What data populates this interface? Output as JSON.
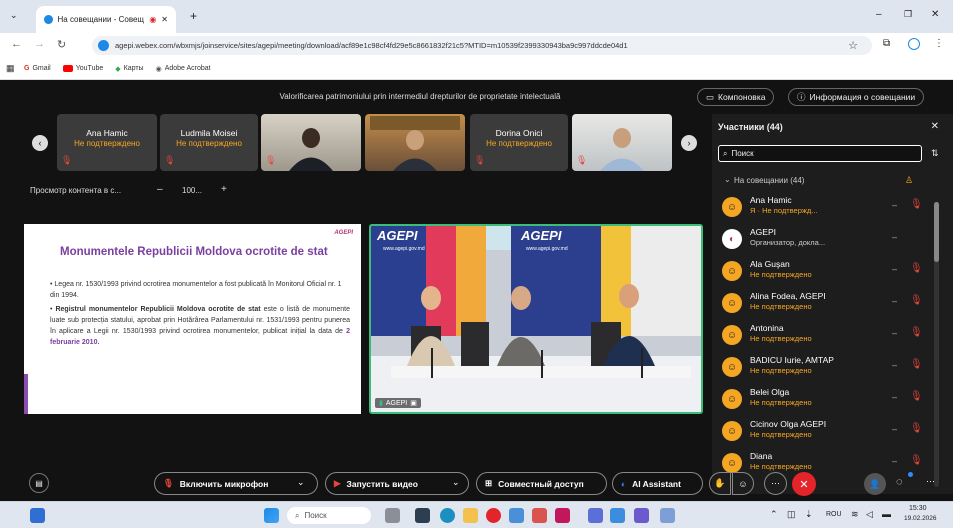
{
  "browser": {
    "tab_title": "На совещании - Совеща",
    "url": "agepi.webex.com/wbxmjs/joinservice/sites/agepi/meeting/download/acf89e1c98cf4fd29e5c8661832f21c5?MTID=m10539f2399330943ba9c997ddcde04d1",
    "bookmarks": [
      "Gmail",
      "YouTube",
      "Карты",
      "Adobe Acrobat"
    ]
  },
  "meeting": {
    "title": "Valorificarea patrimoniului prin intermediul drepturilor de proprietate intelectuală",
    "layout_label": "Компоновка",
    "info_label": "Информация о совещании",
    "view_label": "Просмотр контента в с...",
    "zoom_value": "100...",
    "thumbnails": [
      {
        "name": "Ana Hamic",
        "status": "Не подтверждено"
      },
      {
        "name": "Ludmila Moisei",
        "status": "Не подтверждено"
      },
      {
        "name": "",
        "status": ""
      },
      {
        "name": "",
        "status": ""
      },
      {
        "name": "Dorina Onici",
        "status": "Не подтверждено"
      },
      {
        "name": "",
        "status": ""
      }
    ]
  },
  "slide": {
    "logo": "AGEPI",
    "title": "Monumentele Republicii Moldova ocrotite de stat",
    "bullet1": "Legea nr. 1530/1993 privind ocrotirea monumentelor a fost publicată în Monitorul Oficial nr. 1 din 1994.",
    "bullet2_bold": "Registrul monumentelor Republicii Moldova ocrotite de stat",
    "bullet2_rest": " este o listă de monumente luate sub protecția statului, aprobat prin Hotărârea Parlamentului nr. 1531/1993 pentru punerea în aplicare a Legii nr. 1530/1993 privind ocrotirea monumentelor, publicat inițial la data de ",
    "bullet2_date": "2 februarie 2010."
  },
  "video": {
    "banner_text": "AGEPI",
    "banner_url": "www.agepi.gov.md",
    "label": "AGEPI"
  },
  "panel": {
    "title": "Участники (44)",
    "search_placeholder": "Поиск",
    "section": "На совещании (44)",
    "participants": [
      {
        "name": "Ana Hamic",
        "status": "Я · Не подтвержд...",
        "host": false
      },
      {
        "name": "AGEPI",
        "status": "Организатор, докла...",
        "host": true
      },
      {
        "name": "Ala Guşan",
        "status": "Не подтверждено",
        "host": false
      },
      {
        "name": "Alina Fodea, AGEPI",
        "status": "Не подтверждено",
        "host": false
      },
      {
        "name": "Antonina",
        "status": "Не подтверждено",
        "host": false
      },
      {
        "name": "BADICU Iurie, AMTAP",
        "status": "Не подтверждено",
        "host": false
      },
      {
        "name": "Belei Olga",
        "status": "Не подтверждено",
        "host": false
      },
      {
        "name": "Cicinov Olga AGEPI",
        "status": "Не подтверждено",
        "host": false
      },
      {
        "name": "Diana",
        "status": "Не подтверждено",
        "host": false
      }
    ]
  },
  "toolbar": {
    "mic_label": "Включить микрофон",
    "video_label": "Запустить видео",
    "share_label": "Совместный доступ",
    "ai_label": "AI Assistant"
  },
  "taskbar": {
    "search_placeholder": "Поиск",
    "lang": "ROU",
    "time": "15:30",
    "date": "19.02.2026"
  },
  "colors": {
    "accent": "#f5a623",
    "end_call": "#e3242b",
    "video_border": "#3bbd7a"
  }
}
